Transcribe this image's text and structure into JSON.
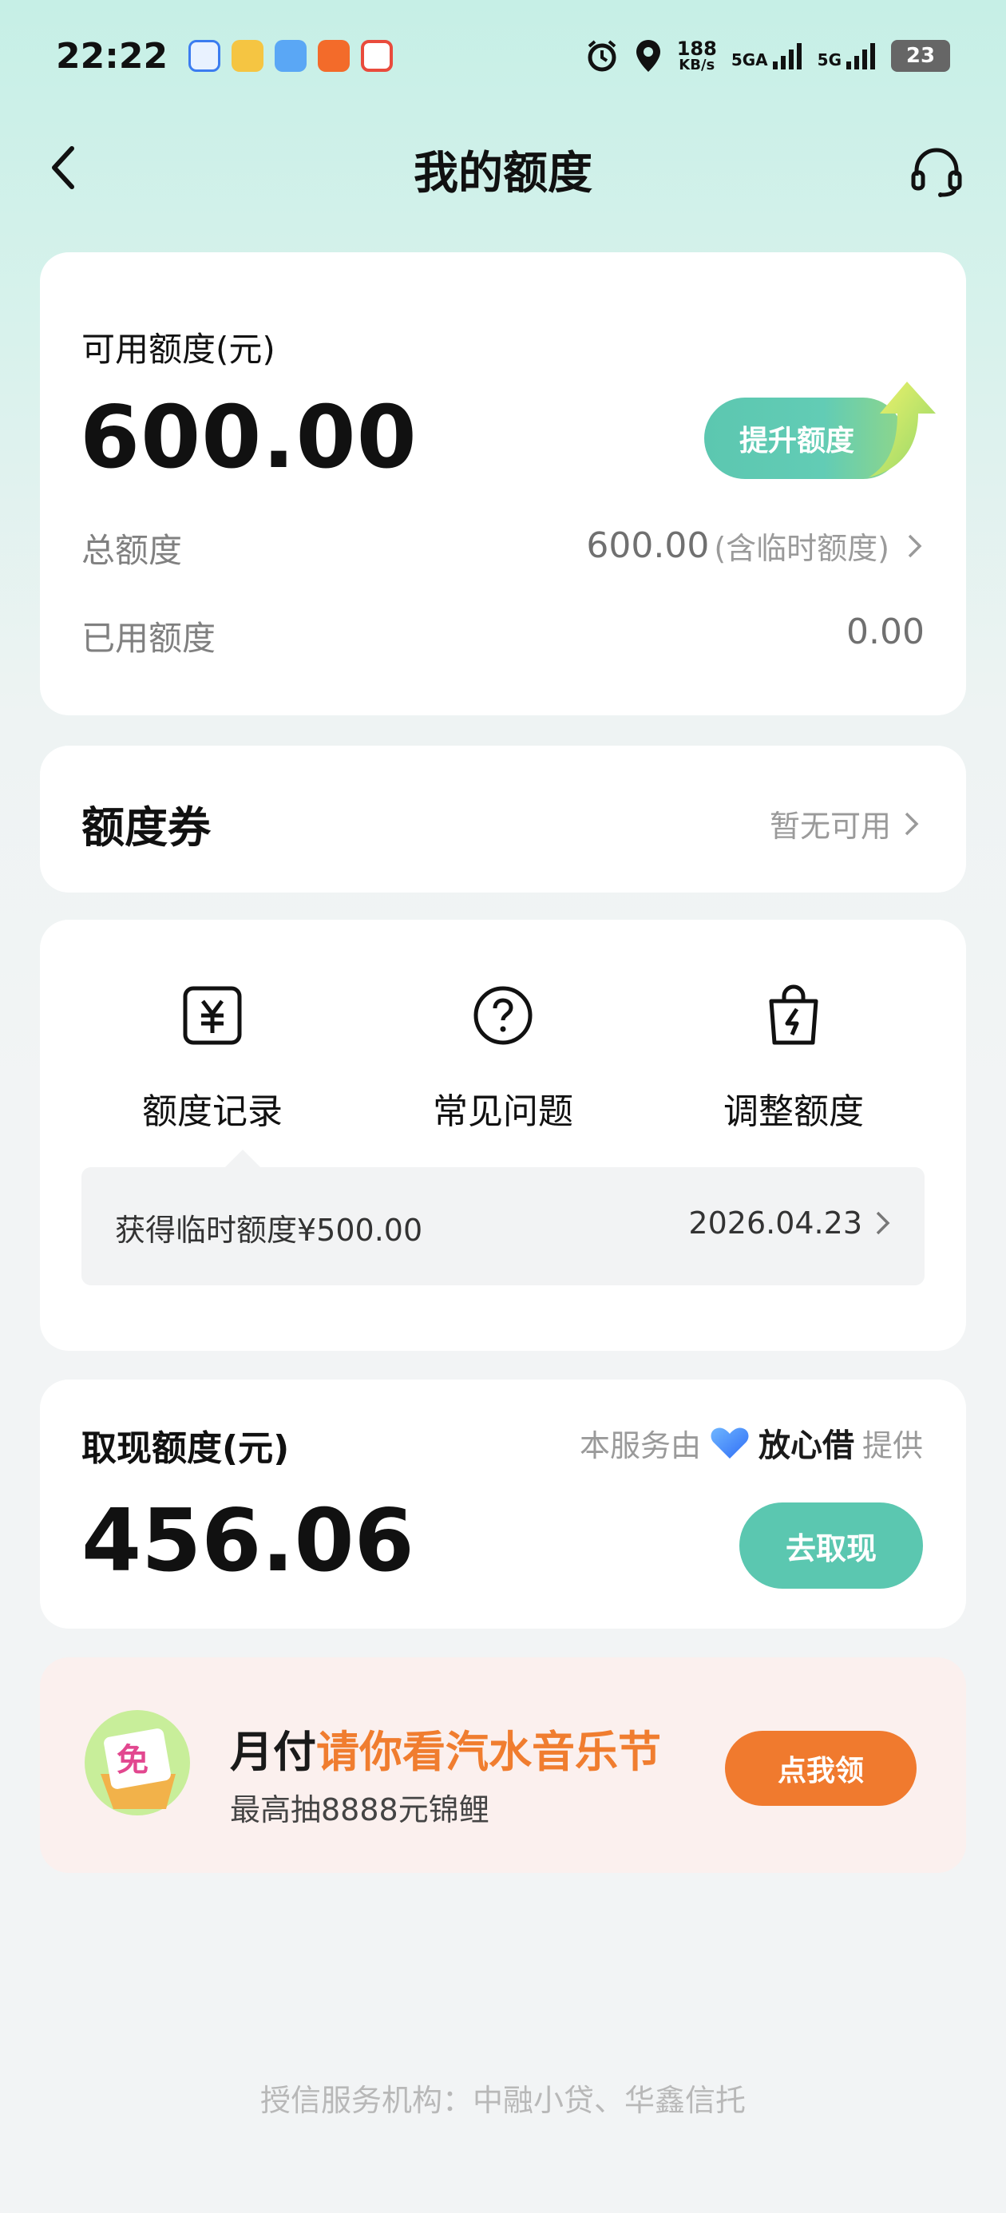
{
  "status_bar": {
    "time": "22:22",
    "net_speed": "188",
    "net_unit": "KB/s",
    "sim1": "5GA",
    "sim2": "5G",
    "battery": "23"
  },
  "nav": {
    "title": "我的额度"
  },
  "limit_card": {
    "available_label": "可用额度(元)",
    "available_amount": "600.00",
    "raise_button": "提升额度",
    "total_label": "总额度",
    "total_value": "600.00",
    "total_note": "(含临时额度)",
    "used_label": "已用额度",
    "used_value": "0.00"
  },
  "voucher_card": {
    "label": "额度券",
    "status": "暂无可用"
  },
  "quick_actions": {
    "items": [
      {
        "label": "额度记录",
        "icon": "yuan-record-icon"
      },
      {
        "label": "常见问题",
        "icon": "question-icon"
      },
      {
        "label": "调整额度",
        "icon": "lightning-bag-icon"
      }
    ],
    "tip_text": "获得临时额度¥500.00",
    "tip_date": "2026.04.23"
  },
  "cash_card": {
    "label": "取现额度(元)",
    "provider_prefix": "本服务由",
    "provider_brand": "放心借",
    "provider_suffix": "提供",
    "amount": "456.06",
    "withdraw_button": "去取现"
  },
  "promo_card": {
    "title_prefix": "月付",
    "title_highlight": "请你看汽水音乐节",
    "subtitle": "最高抽8888元锦鲤",
    "button": "点我领",
    "icon_text": "免"
  },
  "footer": {
    "text": "授信服务机构：中融小贷、华鑫信托"
  },
  "colors": {
    "accent": "#5bc7b0",
    "promo_orange": "#f07a2e"
  }
}
